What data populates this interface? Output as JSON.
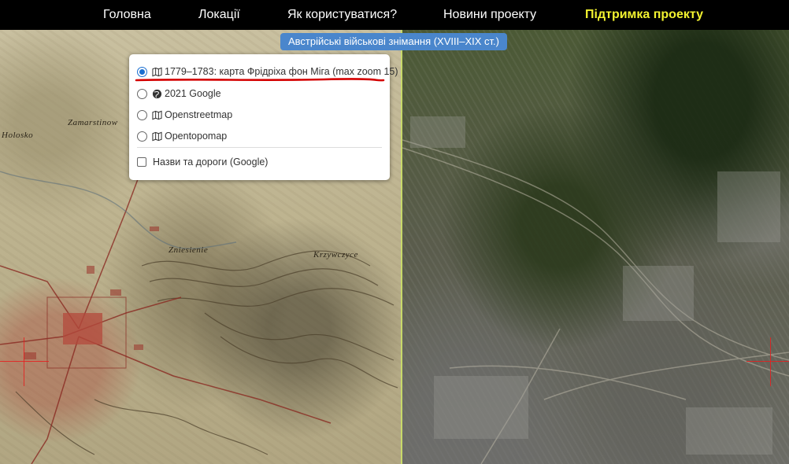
{
  "nav": {
    "items": [
      {
        "label": "Головна"
      },
      {
        "label": "Локації"
      },
      {
        "label": "Як користуватися?"
      },
      {
        "label": "Новини проекту"
      },
      {
        "label": "Підтримка проекту"
      }
    ]
  },
  "banner": {
    "label": "Австрійські військові знімання (XVIII–XIX ст.)"
  },
  "layers": {
    "base": [
      {
        "label": "1779–1783: карта Фрідріха фон Міга (max zoom 15)",
        "icon": "map-icon",
        "checked": true
      },
      {
        "label": "2021 Google",
        "icon": "globe-icon",
        "checked": false
      },
      {
        "label": "Openstreetmap",
        "icon": "map-icon",
        "checked": false
      },
      {
        "label": "Opentopomap",
        "icon": "map-icon",
        "checked": false
      }
    ],
    "overlays": [
      {
        "label": "Назви та дороги (Google)",
        "checked": false
      }
    ]
  },
  "map_labels": [
    {
      "text": "Zamarstinow"
    },
    {
      "text": "Zniesienie"
    },
    {
      "text": "Krzywczyce"
    },
    {
      "text": "Holosko"
    }
  ],
  "colors": {
    "accent_underline": "#d40000",
    "support_link": "#f2f230",
    "banner_bg": "#4a86cc",
    "divider": "#c8d96a"
  }
}
